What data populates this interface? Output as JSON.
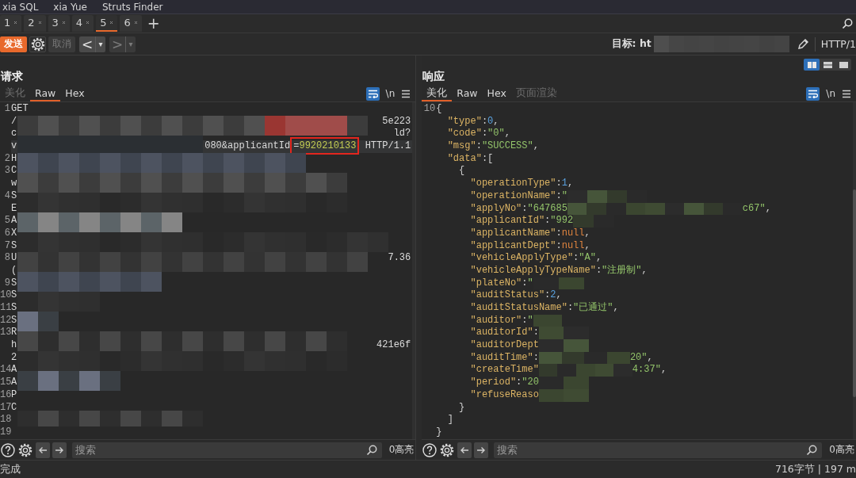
{
  "menu": [
    {
      "label": "xia SQL"
    },
    {
      "label": "xia Yue"
    },
    {
      "label": "Struts Finder"
    }
  ],
  "repeater_tabs": [
    {
      "label": "1",
      "selected": false
    },
    {
      "label": "2",
      "selected": false
    },
    {
      "label": "3",
      "selected": false
    },
    {
      "label": "4",
      "selected": false
    },
    {
      "label": "5",
      "selected": true
    },
    {
      "label": "6",
      "selected": false
    }
  ],
  "add_tab": "+",
  "toolbar": {
    "send": "发送",
    "cancel": {
      "label": "取消",
      "disabled": true
    },
    "back": {
      "label": "<",
      "menu": "▾",
      "disabled": false
    },
    "forward": {
      "label": ">",
      "menu": "▾",
      "disabled": true
    },
    "target_label": "目标: ht",
    "protocol": "HTTP/1"
  },
  "layout_buttons": [
    {
      "kind": "columns",
      "selected": true
    },
    {
      "kind": "rows",
      "selected": false
    },
    {
      "kind": "single",
      "selected": false
    }
  ],
  "request": {
    "title": "请求",
    "tabs": [
      {
        "label": "美化",
        "selected": false,
        "disabled": true
      },
      {
        "label": "Raw",
        "selected": true,
        "disabled": false
      },
      {
        "label": "Hex",
        "selected": false,
        "disabled": false
      }
    ],
    "wrap_on": true,
    "newline_label": "\\n",
    "lines": [
      {
        "number": "1",
        "text": "GET",
        "current": false
      },
      {
        "text": "/",
        "tail": "5e223",
        "current": false
      },
      {
        "text": "c",
        "tail": "ld?",
        "current": false
      },
      {
        "text": "v",
        "current": true,
        "tokens": [
          {
            "kind": "plain",
            "s": "080&applicantId"
          },
          {
            "kind": "box",
            "tokens": [
              {
                "kind": "plain",
                "s": "="
              },
              {
                "kind": "value",
                "s": "9920210133"
              }
            ]
          },
          {
            "kind": "plain",
            "s": " HTTP/1.1"
          }
        ]
      },
      {
        "number": "2",
        "text": "H",
        "current": false
      },
      {
        "number": "3",
        "text": "C",
        "current": false
      },
      {
        "text": "w",
        "current": false
      },
      {
        "number": "4",
        "text": "S",
        "current": false
      },
      {
        "text": "E",
        "current": false
      },
      {
        "number": "5",
        "text": "A",
        "current": false
      },
      {
        "number": "6",
        "text": "X",
        "current": false
      },
      {
        "number": "7",
        "text": "S",
        "current": false
      },
      {
        "number": "8",
        "text": "U",
        "tail": "7.36",
        "current": false
      },
      {
        "text": "(",
        "current": false
      },
      {
        "number": "9",
        "text": "S",
        "current": false
      },
      {
        "number": "10",
        "text": "S",
        "current": false
      },
      {
        "number": "11",
        "text": "S",
        "current": false
      },
      {
        "number": "12",
        "text": "S",
        "current": false
      },
      {
        "number": "13",
        "text": "R",
        "current": false
      },
      {
        "text": "h",
        "tail": "421e6f",
        "current": false
      },
      {
        "text": "2",
        "current": false
      },
      {
        "number": "14",
        "text": "A",
        "current": false
      },
      {
        "number": "15",
        "text": "A",
        "current": false
      },
      {
        "number": "16",
        "text": "P",
        "current": false
      },
      {
        "number": "17",
        "text": "C",
        "current": false
      },
      {
        "number": "18",
        "current": false
      },
      {
        "number": "19",
        "current": false
      }
    ],
    "search_placeholder": "搜索",
    "highlights": "0高亮"
  },
  "response": {
    "title": "响应",
    "tabs": [
      {
        "label": "美化",
        "selected": true,
        "disabled": false
      },
      {
        "label": "Raw",
        "selected": false,
        "disabled": false
      },
      {
        "label": "Hex",
        "selected": false,
        "disabled": false
      },
      {
        "label": "页面渲染",
        "selected": false,
        "disabled": true
      }
    ],
    "wrap_on": true,
    "newline_label": "\\n",
    "lines": [
      {
        "number": "10",
        "tokens": [
          {
            "kind": "punct",
            "s": "{"
          }
        ]
      },
      {
        "tokens": [
          {
            "kind": "key",
            "s": "  \"type\""
          },
          {
            "kind": "punct",
            "s": ":"
          },
          {
            "kind": "num",
            "s": "0"
          },
          {
            "kind": "punct",
            "s": ","
          }
        ]
      },
      {
        "tokens": [
          {
            "kind": "key",
            "s": "  \"code\""
          },
          {
            "kind": "punct",
            "s": ":"
          },
          {
            "kind": "str",
            "s": "\"0\""
          },
          {
            "kind": "punct",
            "s": ","
          }
        ]
      },
      {
        "tokens": [
          {
            "kind": "key",
            "s": "  \"msg\""
          },
          {
            "kind": "punct",
            "s": ":"
          },
          {
            "kind": "str",
            "s": "\"SUCCESS\""
          },
          {
            "kind": "punct",
            "s": ","
          }
        ]
      },
      {
        "tokens": [
          {
            "kind": "key",
            "s": "  \"data\""
          },
          {
            "kind": "punct",
            "s": ":["
          }
        ]
      },
      {
        "tokens": [
          {
            "kind": "punct",
            "s": "    {"
          }
        ]
      },
      {
        "tokens": [
          {
            "kind": "key",
            "s": "      \"operationType\""
          },
          {
            "kind": "punct",
            "s": ":"
          },
          {
            "kind": "num",
            "s": "1"
          },
          {
            "kind": "punct",
            "s": ","
          }
        ]
      },
      {
        "tokens": [
          {
            "kind": "key",
            "s": "      \"operationName\""
          },
          {
            "kind": "punct",
            "s": ":"
          },
          {
            "kind": "str",
            "s": "\""
          },
          {
            "kind": "redacted"
          }
        ]
      },
      {
        "tokens": [
          {
            "kind": "key",
            "s": "      \"applyNo\""
          },
          {
            "kind": "punct",
            "s": ":"
          },
          {
            "kind": "str",
            "s": "\"647685"
          },
          {
            "kind": "redacted"
          },
          {
            "kind": "str",
            "s": "c67\""
          },
          {
            "kind": "punct",
            "s": ","
          }
        ]
      },
      {
        "tokens": [
          {
            "kind": "key",
            "s": "      \"applicantId\""
          },
          {
            "kind": "punct",
            "s": ":"
          },
          {
            "kind": "str",
            "s": "\"992"
          },
          {
            "kind": "redacted"
          }
        ]
      },
      {
        "tokens": [
          {
            "kind": "key",
            "s": "      \"applicantName\""
          },
          {
            "kind": "punct",
            "s": ":"
          },
          {
            "kind": "null",
            "s": "null"
          },
          {
            "kind": "punct",
            "s": ","
          }
        ]
      },
      {
        "tokens": [
          {
            "kind": "key",
            "s": "      \"applicantDept\""
          },
          {
            "kind": "punct",
            "s": ":"
          },
          {
            "kind": "null",
            "s": "null"
          },
          {
            "kind": "punct",
            "s": ","
          }
        ]
      },
      {
        "tokens": [
          {
            "kind": "key",
            "s": "      \"vehicleApplyType\""
          },
          {
            "kind": "punct",
            "s": ":"
          },
          {
            "kind": "str",
            "s": "\"A\""
          },
          {
            "kind": "punct",
            "s": ","
          }
        ]
      },
      {
        "tokens": [
          {
            "kind": "key",
            "s": "      \"vehicleApplyTypeName\""
          },
          {
            "kind": "punct",
            "s": ":"
          },
          {
            "kind": "str",
            "s": "\"注册制\""
          },
          {
            "kind": "punct",
            "s": ","
          }
        ]
      },
      {
        "tokens": [
          {
            "kind": "key",
            "s": "      \"plateNo\""
          },
          {
            "kind": "punct",
            "s": ":"
          },
          {
            "kind": "str",
            "s": "\""
          },
          {
            "kind": "redacted"
          }
        ]
      },
      {
        "tokens": [
          {
            "kind": "key",
            "s": "      \"auditStatus\""
          },
          {
            "kind": "punct",
            "s": ":"
          },
          {
            "kind": "num",
            "s": "2"
          },
          {
            "kind": "punct",
            "s": ","
          }
        ]
      },
      {
        "tokens": [
          {
            "kind": "key",
            "s": "      \"auditStatusName\""
          },
          {
            "kind": "punct",
            "s": ":"
          },
          {
            "kind": "str",
            "s": "\"已通过\""
          },
          {
            "kind": "punct",
            "s": ","
          }
        ]
      },
      {
        "tokens": [
          {
            "kind": "key",
            "s": "      \"auditor\""
          },
          {
            "kind": "punct",
            "s": ":"
          },
          {
            "kind": "str",
            "s": "\""
          },
          {
            "kind": "redacted"
          }
        ]
      },
      {
        "tokens": [
          {
            "kind": "key",
            "s": "      \"auditorId\""
          },
          {
            "kind": "punct",
            "s": ":"
          },
          {
            "kind": "redacted"
          }
        ]
      },
      {
        "tokens": [
          {
            "kind": "key",
            "s": "      \"auditorDept"
          },
          {
            "kind": "redacted"
          }
        ]
      },
      {
        "tokens": [
          {
            "kind": "key",
            "s": "      \"auditTime\""
          },
          {
            "kind": "punct",
            "s": ":"
          },
          {
            "kind": "redacted"
          },
          {
            "kind": "str",
            "s": "20\""
          },
          {
            "kind": "punct",
            "s": ","
          }
        ]
      },
      {
        "tokens": [
          {
            "kind": "key",
            "s": "      \"createTime\""
          },
          {
            "kind": "redacted"
          },
          {
            "kind": "str",
            "s": "4:37\""
          },
          {
            "kind": "punct",
            "s": ","
          }
        ]
      },
      {
        "tokens": [
          {
            "kind": "key",
            "s": "      \"period\""
          },
          {
            "kind": "punct",
            "s": ":"
          },
          {
            "kind": "str",
            "s": "\"20"
          },
          {
            "kind": "redacted"
          }
        ]
      },
      {
        "tokens": [
          {
            "kind": "key",
            "s": "      \"refuseReaso"
          },
          {
            "kind": "redacted"
          }
        ]
      },
      {
        "tokens": [
          {
            "kind": "punct",
            "s": "    }"
          }
        ]
      },
      {
        "tokens": [
          {
            "kind": "punct",
            "s": "  ]"
          }
        ]
      },
      {
        "tokens": [
          {
            "kind": "punct",
            "s": "}"
          }
        ]
      }
    ],
    "search_placeholder": "搜索",
    "highlights": "0高亮"
  },
  "status": {
    "left": "完成",
    "right": "716字节 | 197 m"
  }
}
